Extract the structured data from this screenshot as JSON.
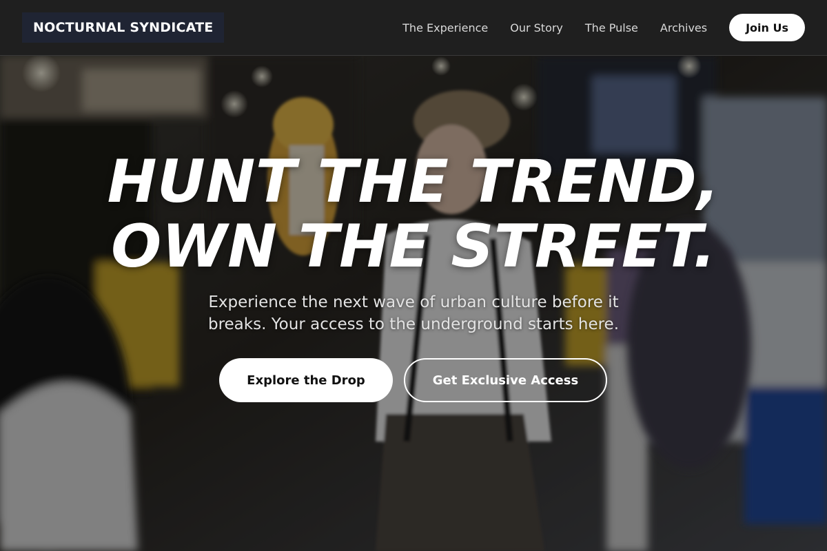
{
  "brand": {
    "name": "NOCTURNAL SYNDICATE"
  },
  "nav": {
    "links": [
      "The Experience",
      "Our Story",
      "The Pulse",
      "Archives"
    ],
    "cta_label": "Join Us"
  },
  "hero": {
    "headline_lines": [
      "HUNT THE TREND,",
      "OWN THE STREET."
    ],
    "subtext_lines": [
      "Experience the next wave of urban culture before it",
      "breaks. Your access to the underground starts here."
    ],
    "primary_cta": "Explore the Drop",
    "secondary_cta": "Get Exclusive Access",
    "background": "blurred night street-fashion crowd photo, woman in plaid cap and suspenders"
  },
  "colors": {
    "nav_bg": "#1f1f1f",
    "brand_bg": "#1f2433",
    "button_bg": "#ffffff",
    "button_text": "#111111"
  }
}
